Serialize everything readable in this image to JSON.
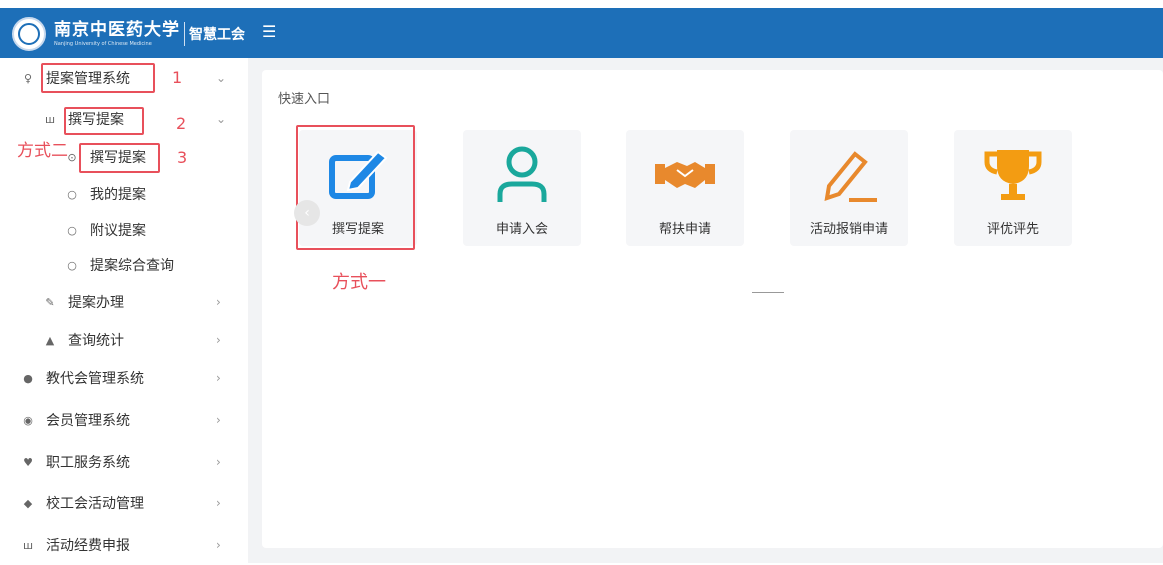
{
  "header": {
    "university_cn": "南京中医药大学",
    "university_en": "Nanjing University of Chinese Medicine",
    "app_title": "智慧工会",
    "menu_icon": "hamburger-icon"
  },
  "sidebar": {
    "items": [
      {
        "label": "提案管理系统",
        "icon": "lightbulb-icon"
      },
      {
        "label": "撰写提案",
        "icon": "grid-icon"
      },
      {
        "label": "撰写提案"
      },
      {
        "label": "我的提案"
      },
      {
        "label": "附议提案"
      },
      {
        "label": "提案综合查询"
      },
      {
        "label": "提案办理",
        "icon": "edit-icon"
      },
      {
        "label": "查询统计",
        "icon": "chart-icon"
      },
      {
        "label": "教代会管理系统",
        "icon": "users-icon"
      },
      {
        "label": "会员管理系统",
        "icon": "user-circle-icon"
      },
      {
        "label": "职工服务系统",
        "icon": "heart-icon"
      },
      {
        "label": "校工会活动管理",
        "icon": "tag-icon"
      },
      {
        "label": "活动经费申报",
        "icon": "grid-icon"
      }
    ]
  },
  "annotations": {
    "num1": "1",
    "num2": "2",
    "num3": "3",
    "method2": "方式二",
    "method1": "方式一"
  },
  "main": {
    "section_title": "快速入口",
    "tiles": [
      {
        "label": "撰写提案",
        "icon": "edit-document-icon"
      },
      {
        "label": "申请入会",
        "icon": "person-icon"
      },
      {
        "label": "帮扶申请",
        "icon": "handshake-icon"
      },
      {
        "label": "活动报销申请",
        "icon": "pencil-icon"
      },
      {
        "label": "评优评先",
        "icon": "trophy-icon"
      }
    ],
    "prev_arrow": "‹"
  },
  "colors": {
    "header": "#1d6fb8",
    "accent_blue": "#1e88e5",
    "teal": "#1aa89c",
    "orange": "#e8892d",
    "annotation_red": "#e8505b"
  }
}
